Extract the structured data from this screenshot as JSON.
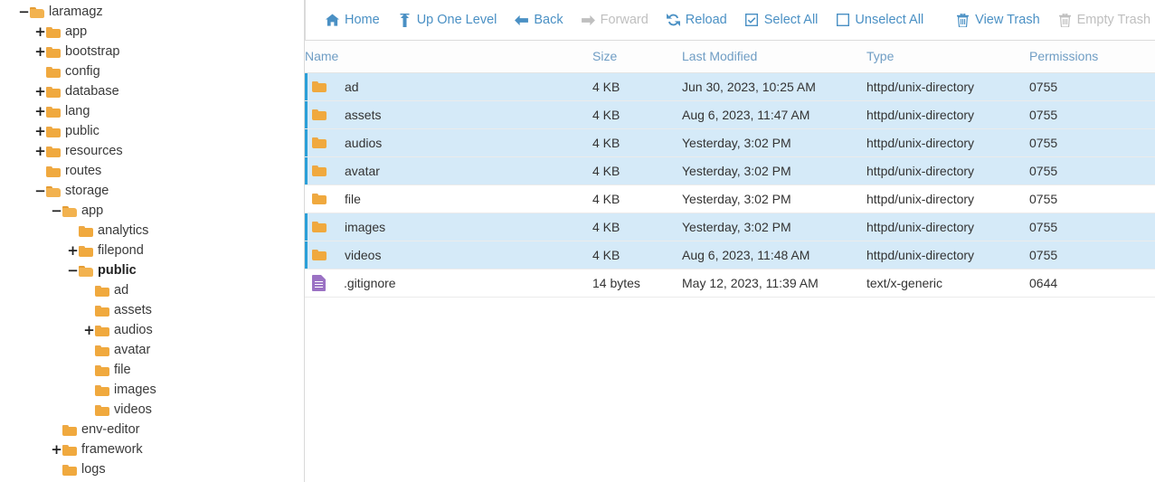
{
  "sidebar": {
    "tree": [
      {
        "label": "laramagz",
        "indent": 0,
        "twisty": "−",
        "open": true,
        "current": false
      },
      {
        "label": "app",
        "indent": 1,
        "twisty": "+",
        "open": false,
        "current": false
      },
      {
        "label": "bootstrap",
        "indent": 1,
        "twisty": "+",
        "open": false,
        "current": false
      },
      {
        "label": "config",
        "indent": 1,
        "twisty": "",
        "open": false,
        "current": false
      },
      {
        "label": "database",
        "indent": 1,
        "twisty": "+",
        "open": false,
        "current": false
      },
      {
        "label": "lang",
        "indent": 1,
        "twisty": "+",
        "open": false,
        "current": false
      },
      {
        "label": "public",
        "indent": 1,
        "twisty": "+",
        "open": false,
        "current": false
      },
      {
        "label": "resources",
        "indent": 1,
        "twisty": "+",
        "open": false,
        "current": false
      },
      {
        "label": "routes",
        "indent": 1,
        "twisty": "",
        "open": false,
        "current": false
      },
      {
        "label": "storage",
        "indent": 1,
        "twisty": "−",
        "open": true,
        "current": false
      },
      {
        "label": "app",
        "indent": 2,
        "twisty": "−",
        "open": true,
        "current": false
      },
      {
        "label": "analytics",
        "indent": 3,
        "twisty": "",
        "open": false,
        "current": false
      },
      {
        "label": "filepond",
        "indent": 3,
        "twisty": "+",
        "open": false,
        "current": false
      },
      {
        "label": "public",
        "indent": 3,
        "twisty": "−",
        "open": true,
        "current": true
      },
      {
        "label": "ad",
        "indent": 4,
        "twisty": "",
        "open": false,
        "current": false
      },
      {
        "label": "assets",
        "indent": 4,
        "twisty": "",
        "open": false,
        "current": false
      },
      {
        "label": "audios",
        "indent": 4,
        "twisty": "+",
        "open": false,
        "current": false
      },
      {
        "label": "avatar",
        "indent": 4,
        "twisty": "",
        "open": false,
        "current": false
      },
      {
        "label": "file",
        "indent": 4,
        "twisty": "",
        "open": false,
        "current": false
      },
      {
        "label": "images",
        "indent": 4,
        "twisty": "",
        "open": false,
        "current": false
      },
      {
        "label": "videos",
        "indent": 4,
        "twisty": "",
        "open": false,
        "current": false
      },
      {
        "label": "env-editor",
        "indent": 2,
        "twisty": "",
        "open": false,
        "current": false
      },
      {
        "label": "framework",
        "indent": 2,
        "twisty": "+",
        "open": false,
        "current": false
      },
      {
        "label": "logs",
        "indent": 2,
        "twisty": "",
        "open": false,
        "current": false
      }
    ]
  },
  "toolbar": {
    "buttons": [
      {
        "label": "Home",
        "icon": "home-icon",
        "disabled": false
      },
      {
        "label": "Up One Level",
        "icon": "arrow-up-icon",
        "disabled": false
      },
      {
        "label": "Back",
        "icon": "arrow-left-icon",
        "disabled": false
      },
      {
        "label": "Forward",
        "icon": "arrow-right-icon",
        "disabled": true
      },
      {
        "label": "Reload",
        "icon": "refresh-icon",
        "disabled": false
      },
      {
        "label": "Select All",
        "icon": "checkbox-checked-icon",
        "disabled": false
      },
      {
        "label": "Unselect All",
        "icon": "checkbox-empty-icon",
        "disabled": false
      },
      {
        "label": "View Trash",
        "icon": "trash-icon",
        "disabled": false
      },
      {
        "label": "Empty Trash",
        "icon": "trash-icon",
        "disabled": true
      }
    ],
    "separator_after_index": 6
  },
  "table": {
    "columns": [
      "Name",
      "Size",
      "Last Modified",
      "Type",
      "Permissions"
    ],
    "rows": [
      {
        "name": "ad",
        "size": "4 KB",
        "modified": "Jun 30, 2023, 10:25 AM",
        "type": "httpd/unix-directory",
        "permissions": "0755",
        "icon": "folder-icon",
        "selected": true
      },
      {
        "name": "assets",
        "size": "4 KB",
        "modified": "Aug 6, 2023, 11:47 AM",
        "type": "httpd/unix-directory",
        "permissions": "0755",
        "icon": "folder-icon",
        "selected": true
      },
      {
        "name": "audios",
        "size": "4 KB",
        "modified": "Yesterday, 3:02 PM",
        "type": "httpd/unix-directory",
        "permissions": "0755",
        "icon": "folder-icon",
        "selected": true
      },
      {
        "name": "avatar",
        "size": "4 KB",
        "modified": "Yesterday, 3:02 PM",
        "type": "httpd/unix-directory",
        "permissions": "0755",
        "icon": "folder-icon",
        "selected": true
      },
      {
        "name": "file",
        "size": "4 KB",
        "modified": "Yesterday, 3:02 PM",
        "type": "httpd/unix-directory",
        "permissions": "0755",
        "icon": "folder-icon",
        "selected": false
      },
      {
        "name": "images",
        "size": "4 KB",
        "modified": "Yesterday, 3:02 PM",
        "type": "httpd/unix-directory",
        "permissions": "0755",
        "icon": "folder-icon",
        "selected": true
      },
      {
        "name": "videos",
        "size": "4 KB",
        "modified": "Aug 6, 2023, 11:48 AM",
        "type": "httpd/unix-directory",
        "permissions": "0755",
        "icon": "folder-icon",
        "selected": true
      },
      {
        "name": ".gitignore",
        "size": "14 bytes",
        "modified": "May 12, 2023, 11:39 AM",
        "type": "text/x-generic",
        "permissions": "0644",
        "icon": "document-icon",
        "selected": false
      }
    ]
  },
  "colors": {
    "accent": "#4a90c4",
    "selected_row": "#d5eaf8",
    "selected_marker": "#2a9fd8",
    "folder": "#f0a93e",
    "document": "#9b72c4",
    "header_text": "#6f9dc4",
    "disabled": "#bfbfbf"
  }
}
